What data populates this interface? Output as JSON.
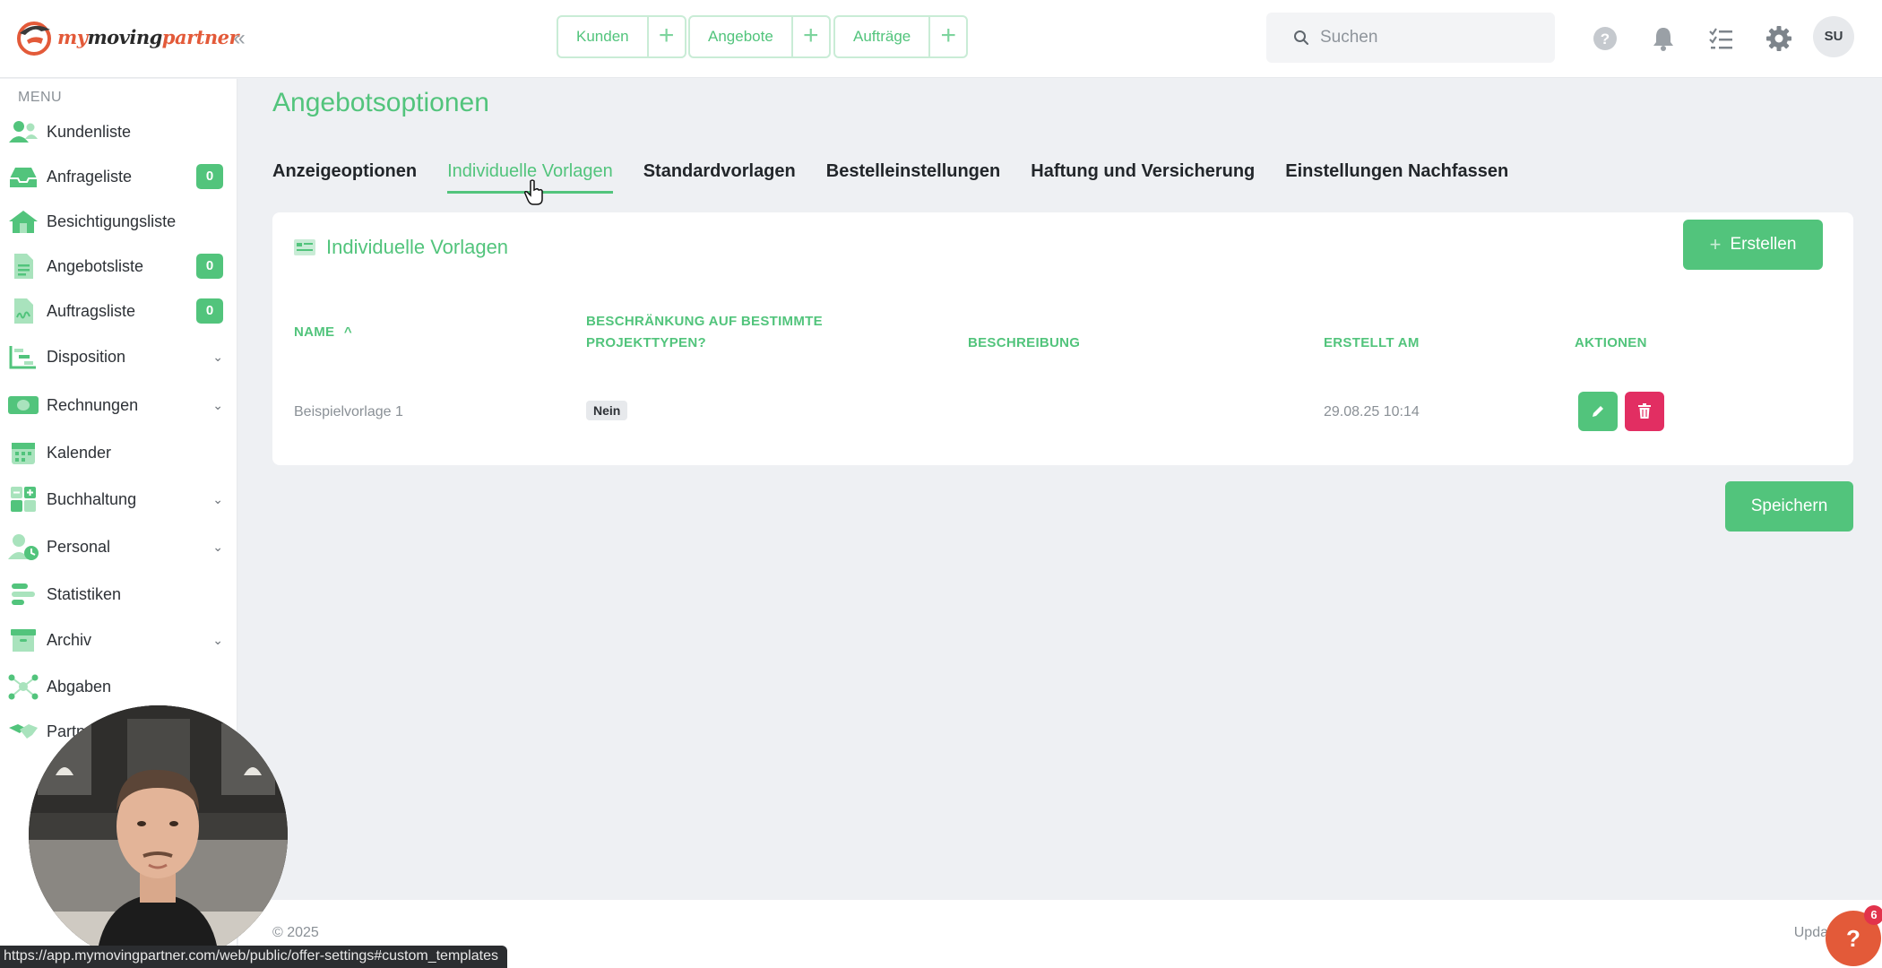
{
  "brand": {
    "logo_my": "my",
    "logo_moving": "moving",
    "logo_partner": "partner"
  },
  "header": {
    "quicknav": [
      {
        "label": "Kunden"
      },
      {
        "label": "Angebote"
      },
      {
        "label": "Aufträge"
      }
    ],
    "search_placeholder": "Suchen",
    "avatar_initials": "SU"
  },
  "sidebar": {
    "menu_title": "MENU",
    "items": [
      {
        "label": "Kundenliste",
        "icon": "users-icon"
      },
      {
        "label": "Anfrageliste",
        "icon": "inbox-icon",
        "badge": "0"
      },
      {
        "label": "Besichtigungsliste",
        "icon": "house-icon"
      },
      {
        "label": "Angebotsliste",
        "icon": "document-icon",
        "badge": "0"
      },
      {
        "label": "Auftragsliste",
        "icon": "signed-document-icon",
        "badge": "0"
      },
      {
        "label": "Disposition",
        "icon": "gantt-icon",
        "expandable": true
      },
      {
        "label": "Rechnungen",
        "icon": "banknote-icon",
        "expandable": true
      },
      {
        "label": "Kalender",
        "icon": "calendar-icon"
      },
      {
        "label": "Buchhaltung",
        "icon": "calculator-icon",
        "expandable": true
      },
      {
        "label": "Personal",
        "icon": "person-clock-icon",
        "expandable": true
      },
      {
        "label": "Statistiken",
        "icon": "bar-chart-icon"
      },
      {
        "label": "Archiv",
        "icon": "archive-icon",
        "expandable": true
      },
      {
        "label": "Abgaben",
        "icon": "network-icon"
      },
      {
        "label": "Partner",
        "icon": "handshake-icon"
      }
    ]
  },
  "main": {
    "page_title": "Angebotsoptionen",
    "tabs": [
      {
        "label": "Anzeigeoptionen"
      },
      {
        "label": "Individuelle Vorlagen",
        "active": true
      },
      {
        "label": "Standardvorlagen"
      },
      {
        "label": "Bestelleinstellungen"
      },
      {
        "label": "Haftung und Versicherung"
      },
      {
        "label": "Einstellungen Nachfassen"
      }
    ],
    "card": {
      "title": "Individuelle Vorlagen",
      "create_label": "Erstellen",
      "columns": {
        "name": "NAME",
        "restriction_line1": "BESCHRÄNKUNG AUF BESTIMMTE",
        "restriction_line2": "PROJEKTTYPEN?",
        "description": "BESCHREIBUNG",
        "created": "ERSTELLT AM",
        "actions": "AKTIONEN"
      },
      "rows": [
        {
          "name": "Beispielvorlage 1",
          "restriction": "Nein",
          "description": "",
          "created": "29.08.25 10:14"
        }
      ]
    },
    "save_label": "Speichern"
  },
  "footer": {
    "copyright": "© 2025",
    "update_text": "Upda"
  },
  "help": {
    "label": "?",
    "count": "6"
  },
  "status_url": "https://app.mymovingpartner.com/web/public/offer-settings#custom_templates",
  "colors": {
    "accent": "#52c47c",
    "danger": "#e22e62",
    "brand": "#e35a39"
  }
}
